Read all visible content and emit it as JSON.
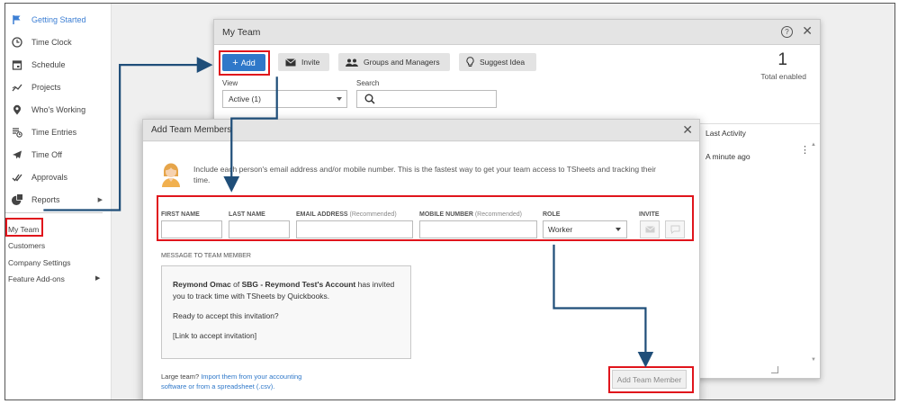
{
  "sidebar": {
    "items": [
      {
        "label": "Getting Started",
        "icon": "flag-icon"
      },
      {
        "label": "Time Clock",
        "icon": "clock-icon"
      },
      {
        "label": "Schedule",
        "icon": "calendar-icon"
      },
      {
        "label": "Projects",
        "icon": "chart-line-icon"
      },
      {
        "label": "Who's Working",
        "icon": "location-pin-icon"
      },
      {
        "label": "Time Entries",
        "icon": "time-entries-icon"
      },
      {
        "label": "Time Off",
        "icon": "plane-icon"
      },
      {
        "label": "Approvals",
        "icon": "checkmark-icon"
      },
      {
        "label": "Reports",
        "icon": "pie-chart-icon"
      }
    ],
    "links": [
      "My Team",
      "Customers",
      "Company Settings",
      "Feature Add-ons"
    ]
  },
  "team_window": {
    "title": "My Team",
    "add_label": "Add",
    "invite_label": "Invite",
    "groups_label": "Groups and Managers",
    "suggest_label": "Suggest Idea",
    "enabled_count": "1",
    "enabled_label": "Total enabled",
    "view_label": "View",
    "view_value": "Active (1)",
    "search_label": "Search",
    "last_activity_header": "Last Activity",
    "last_activity_value": "A minute ago"
  },
  "modal": {
    "title": "Add Team Members",
    "intro": "Include each person's email address and/or mobile number. This is the fastest way to get your team access to TSheets and tracking their time.",
    "first_name_label": "FIRST NAME",
    "last_name_label": "LAST NAME",
    "email_label": "EMAIL ADDRESS",
    "mobile_label": "MOBILE NUMBER",
    "recommended": "(Recommended)",
    "role_label": "ROLE",
    "role_value": "Worker",
    "invite_label": "INVITE",
    "message_label": "MESSAGE TO TEAM MEMBER",
    "message_sender": "Reymond Omac",
    "message_of": "of",
    "message_account": "SBG - Reymond Test's Account",
    "message_rest": "has invited you to track time with TSheets by Quickbooks.",
    "message_line2": "Ready to accept this invitation?",
    "message_line3": "[Link to accept invitation]",
    "large_team_prefix": "Large team?",
    "large_team_link": "Import them from your accounting software or from a spreadsheet (.csv).",
    "add_member_label": "Add Team Member"
  },
  "colors": {
    "accent_blue": "#2f78c9",
    "highlight_red": "#e0151c",
    "arrow_navy": "#1f4e79"
  }
}
